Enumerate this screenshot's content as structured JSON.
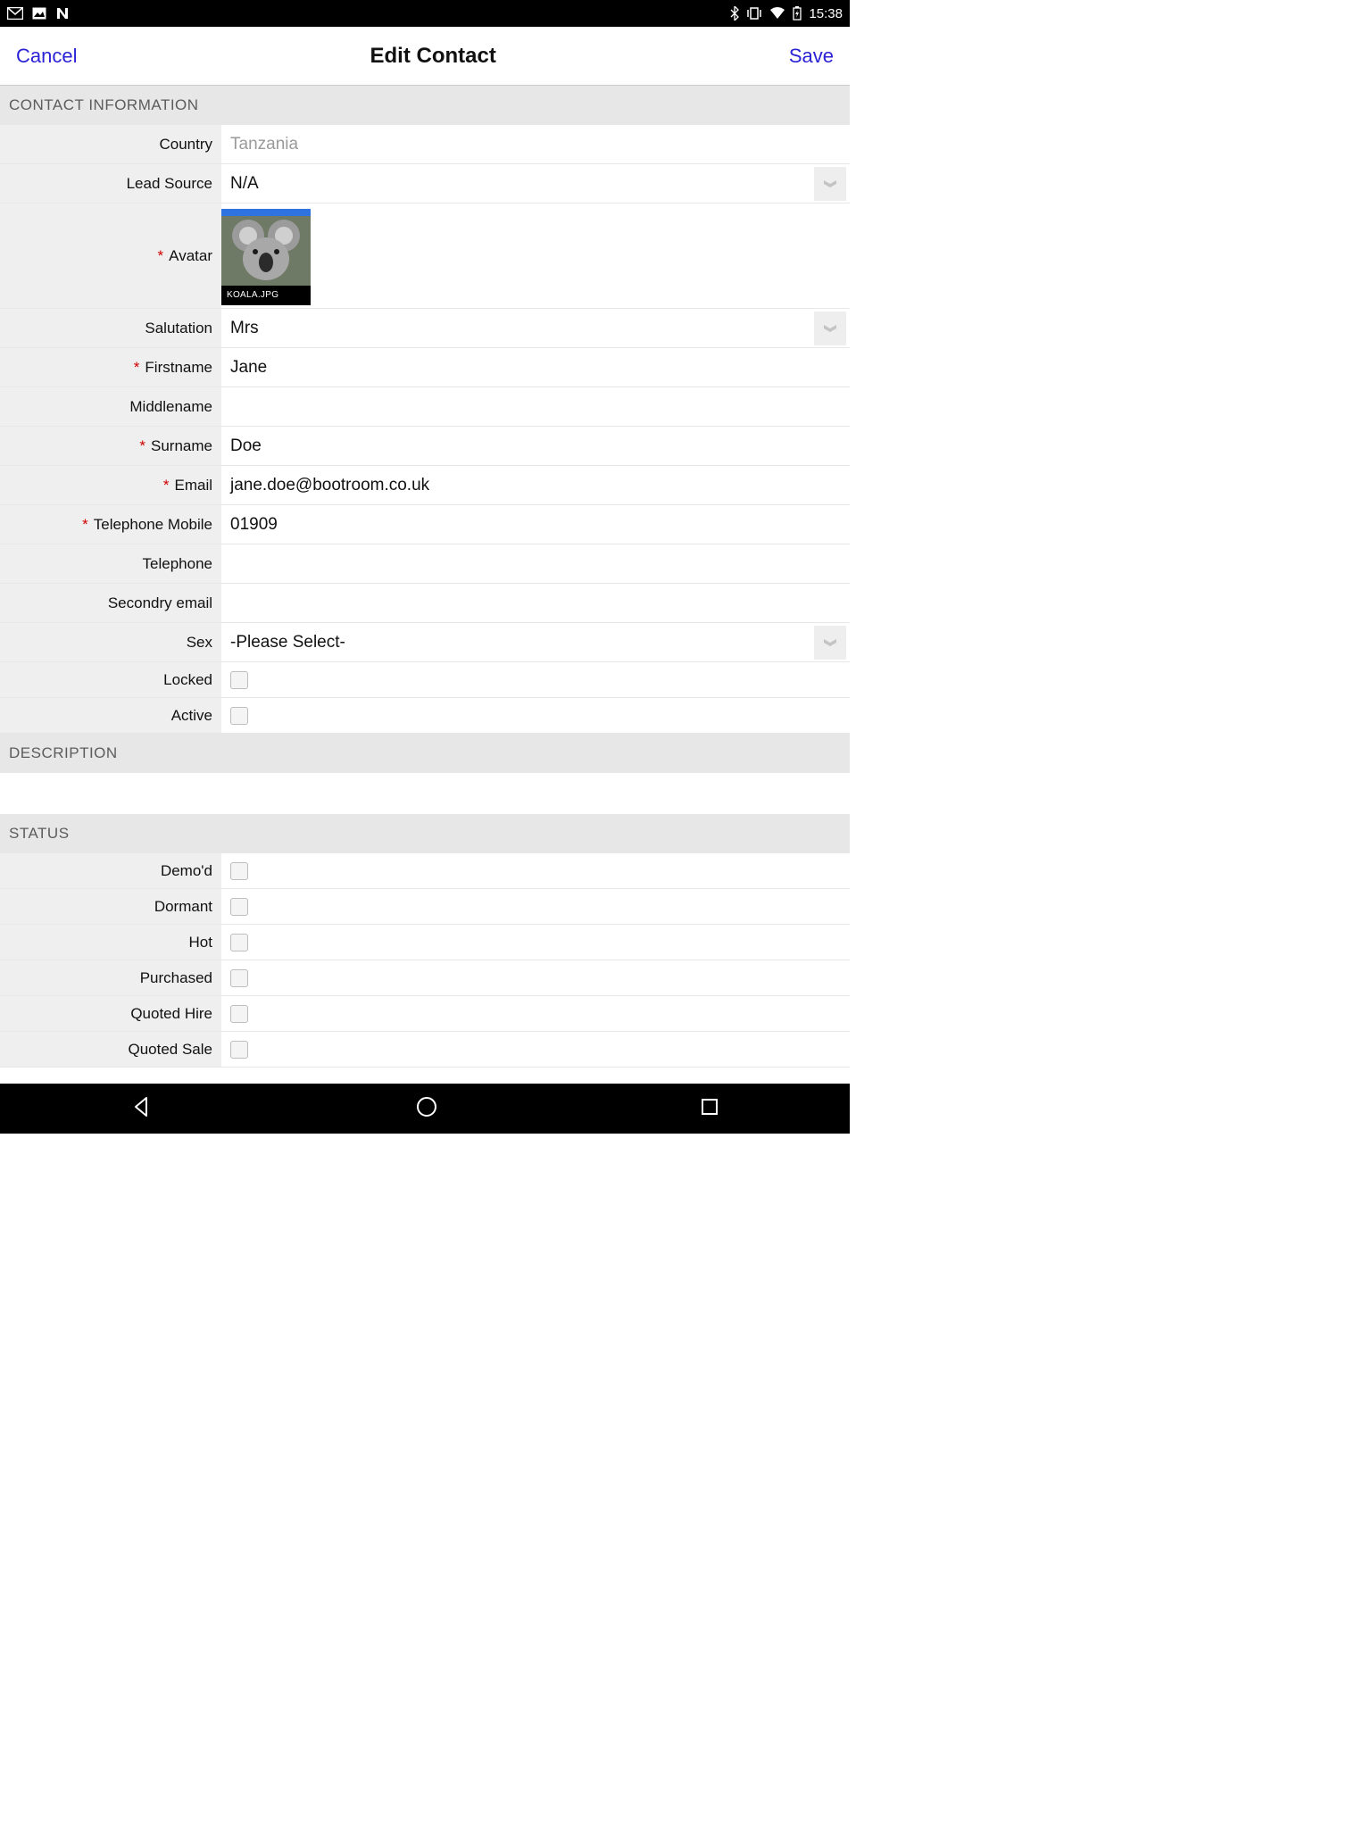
{
  "status_bar": {
    "time": "15:38"
  },
  "header": {
    "cancel": "Cancel",
    "title": "Edit Contact",
    "save": "Save"
  },
  "sections": {
    "contact_info_header": "CONTACT INFORMATION",
    "description_header": "DESCRIPTION",
    "status_header": "STATUS"
  },
  "labels": {
    "country": "Country",
    "lead_source": "Lead Source",
    "avatar": "Avatar",
    "salutation": "Salutation",
    "firstname": "Firstname",
    "middlename": "Middlename",
    "surname": "Surname",
    "email": "Email",
    "tel_mobile": "Telephone Mobile",
    "telephone": "Telephone",
    "secondary_email": "Secondry email",
    "sex": "Sex",
    "locked": "Locked",
    "active": "Active",
    "demod": "Demo'd",
    "dormant": "Dormant",
    "hot": "Hot",
    "purchased": "Purchased",
    "quoted_hire": "Quoted Hire",
    "quoted_sale": "Quoted Sale"
  },
  "values": {
    "country_placeholder": "Tanzania",
    "lead_source": "N/A",
    "avatar_filename": "KOALA.JPG",
    "salutation": "Mrs",
    "firstname": "Jane",
    "middlename": "",
    "surname": "Doe",
    "email": "jane.doe@bootroom.co.uk",
    "tel_mobile": "01909",
    "telephone": "",
    "secondary_email": "",
    "sex": "-Please Select-",
    "locked": false,
    "active": false,
    "demod": false,
    "dormant": false,
    "hot": false,
    "purchased": false,
    "quoted_hire": false,
    "quoted_sale": false
  },
  "required_marker": "*"
}
